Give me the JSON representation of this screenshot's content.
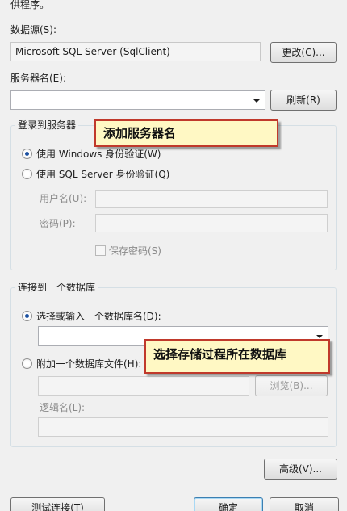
{
  "intro_text": "供程序。",
  "datasource": {
    "label": "数据源(S):",
    "value": "Microsoft SQL Server (SqlClient)",
    "change_button": "更改(C)..."
  },
  "server": {
    "label": "服务器名(E):",
    "value": "",
    "refresh_button": "刷新(R)"
  },
  "login_group": {
    "title": "登录到服务器",
    "windows_auth": "使用 Windows 身份验证(W)",
    "sql_auth": "使用 SQL Server 身份验证(Q)",
    "username_label": "用户名(U):",
    "password_label": "密码(P):",
    "save_password": "保存密码(S)"
  },
  "db_group": {
    "title": "连接到一个数据库",
    "select_db": "选择或输入一个数据库名(D):",
    "attach_file": "附加一个数据库文件(H):",
    "browse_button": "浏览(B)...",
    "logical_name_label": "逻辑名(L):"
  },
  "annotations": {
    "add_server": "添加服务器名",
    "select_db": "选择存储过程所在数据库"
  },
  "buttons": {
    "advanced": "高级(V)...",
    "test_connection": "测试连接(T)",
    "ok": "确定",
    "cancel": "取消"
  },
  "colors": {
    "callout_border": "#c0392b",
    "callout_fill": "#fff8c4",
    "default_button_border": "#3c7fb1"
  }
}
